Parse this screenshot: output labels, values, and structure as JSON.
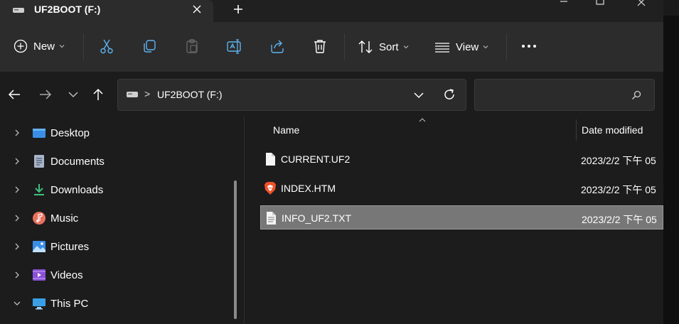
{
  "tab": {
    "title": "UF2BOOT (F:)"
  },
  "toolbar": {
    "new_label": "New",
    "sort_label": "Sort",
    "view_label": "View"
  },
  "address": {
    "separator": ">",
    "path": "UF2BOOT (F:)"
  },
  "search": {
    "placeholder": ""
  },
  "sidebar": {
    "items": [
      {
        "label": "Desktop",
        "icon": "desktop-folder-icon",
        "color": "#3a8ee6"
      },
      {
        "label": "Documents",
        "icon": "documents-folder-icon",
        "color": "#a8b4c8"
      },
      {
        "label": "Downloads",
        "icon": "download-arrow-icon",
        "color": "#3fbf7f"
      },
      {
        "label": "Music",
        "icon": "music-icon",
        "color": "#e8715e"
      },
      {
        "label": "Pictures",
        "icon": "pictures-icon",
        "color": "#3a8ee6"
      },
      {
        "label": "Videos",
        "icon": "videos-icon",
        "color": "#8a4fd8"
      },
      {
        "label": "This PC",
        "icon": "this-pc-icon",
        "color": "#3aa0e6"
      }
    ]
  },
  "columns": {
    "name": "Name",
    "date": "Date modified"
  },
  "files": [
    {
      "name": "CURRENT.UF2",
      "date": "2023/2/2 下午 05",
      "icon": "blank-file-icon",
      "selected": false
    },
    {
      "name": "INDEX.HTM",
      "date": "2023/2/2 下午 05",
      "icon": "brave-browser-icon",
      "selected": false
    },
    {
      "name": "INFO_UF2.TXT",
      "date": "2023/2/2 下午 05",
      "icon": "text-file-icon",
      "selected": true
    }
  ],
  "colors": {
    "accent": "#3a8ee6",
    "selection": "#777777",
    "brave": "#f0522a"
  }
}
